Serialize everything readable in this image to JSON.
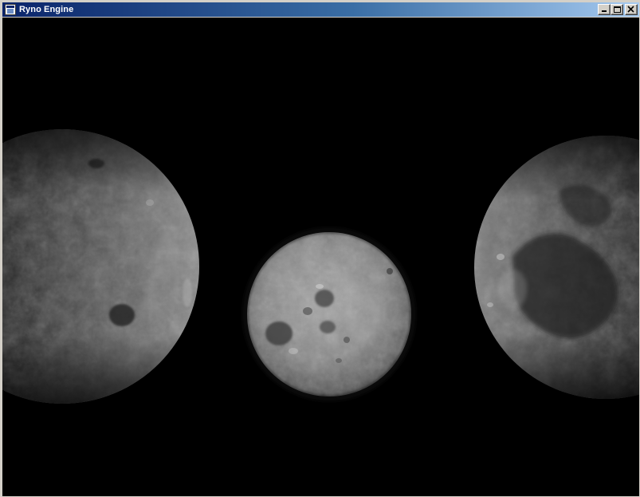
{
  "window": {
    "title": "Ryno Engine",
    "titlebar_colors": [
      "#0a246a",
      "#a6caf0"
    ]
  },
  "caption_buttons": {
    "minimize_icon": "minimize-icon",
    "maximize_icon": "maximize-icon",
    "close_icon": "close-icon"
  },
  "scene": {
    "background": "#000000",
    "objects": [
      "moon-left",
      "moon-center",
      "moon-right"
    ],
    "surface_color": "#9a9a9a"
  }
}
